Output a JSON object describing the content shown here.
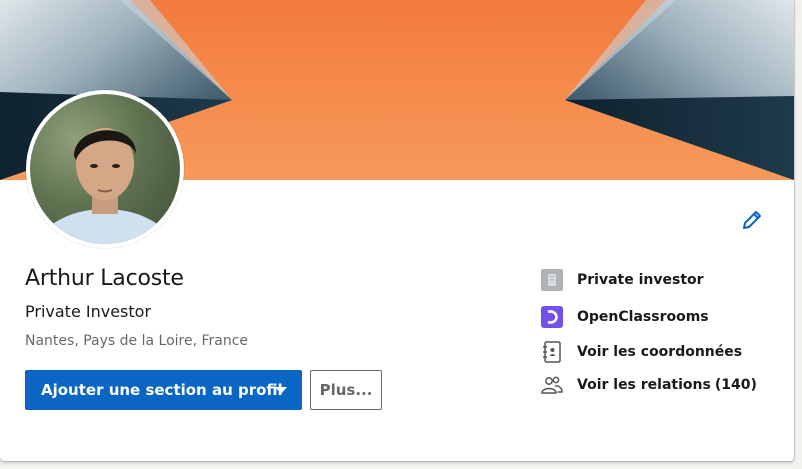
{
  "profile": {
    "name": "Arthur Lacoste",
    "headline": "Private Investor",
    "location": "Nantes, Pays de la Loire, France"
  },
  "actions": {
    "add_section_label": "Ajouter une section au profil",
    "more_label": "Plus..."
  },
  "sidebar": {
    "items": [
      {
        "label": "Private investor",
        "icon": "building-icon"
      },
      {
        "label": "OpenClassrooms",
        "icon": "openclassrooms-logo-icon"
      },
      {
        "label": "Voir les coordonnées",
        "icon": "contact-book-icon"
      },
      {
        "label": "Voir les relations",
        "count": "(140)",
        "icon": "people-icon"
      }
    ]
  },
  "colors": {
    "primary": "#0a66c2",
    "banner_orange": "#f5894a",
    "openclassrooms_purple": "#7451eb"
  }
}
